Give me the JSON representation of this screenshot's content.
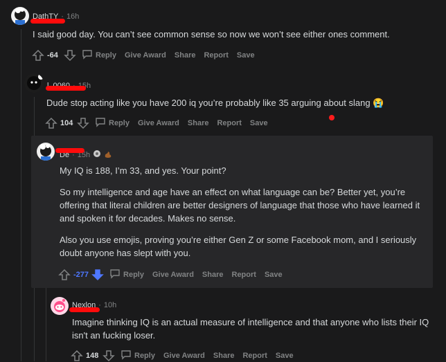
{
  "colors": {
    "background": "#1a1a1b",
    "highlight": "#272729",
    "text": "#d7dadc",
    "muted": "#818384",
    "downvote": "#4e77ff",
    "redact": "#ff0b0b"
  },
  "comments": [
    {
      "username": "DathTY",
      "time": "16h",
      "body": [
        "I said good day. You can’t see common sense so now we won’t see either ones comment."
      ],
      "score": "-64",
      "reply": "Reply",
      "give_award": "Give Award",
      "share": "Share",
      "report": "Report",
      "save": "Save"
    },
    {
      "username": "l_0060",
      "time": "15h",
      "body": [
        "Dude stop acting like you have 200 iq you’re probably like 35 arguing about slang 😭"
      ],
      "score": "104",
      "reply": "Reply",
      "give_award": "Give Award",
      "share": "Share",
      "report": "Report",
      "save": "Save"
    },
    {
      "username": "De",
      "time": "15h",
      "body": [
        "My IQ is 188, I’m 33, and yes. Your point?",
        "So my intelligence and age have an effect on what language can be? Better yet, you’re offering that literal children are better designers of language that those who have learned it and spoken it for decades. Makes no sense.",
        "Also you use emojis, proving you’re either Gen Z or some Facebook mom, and I seriously doubt anyone has slept with you."
      ],
      "score": "-277",
      "reply": "Reply",
      "give_award": "Give Award",
      "share": "Share",
      "report": "Report",
      "save": "Save"
    },
    {
      "username": "Nexlon",
      "time": "10h",
      "body": [
        "Imagine thinking IQ is an actual measure of intelligence and that anyone who lists their IQ isn't an fucking loser."
      ],
      "score": "148",
      "reply": "Reply",
      "give_award": "Give Award",
      "share": "Share",
      "report": "Report",
      "save": "Save"
    }
  ]
}
